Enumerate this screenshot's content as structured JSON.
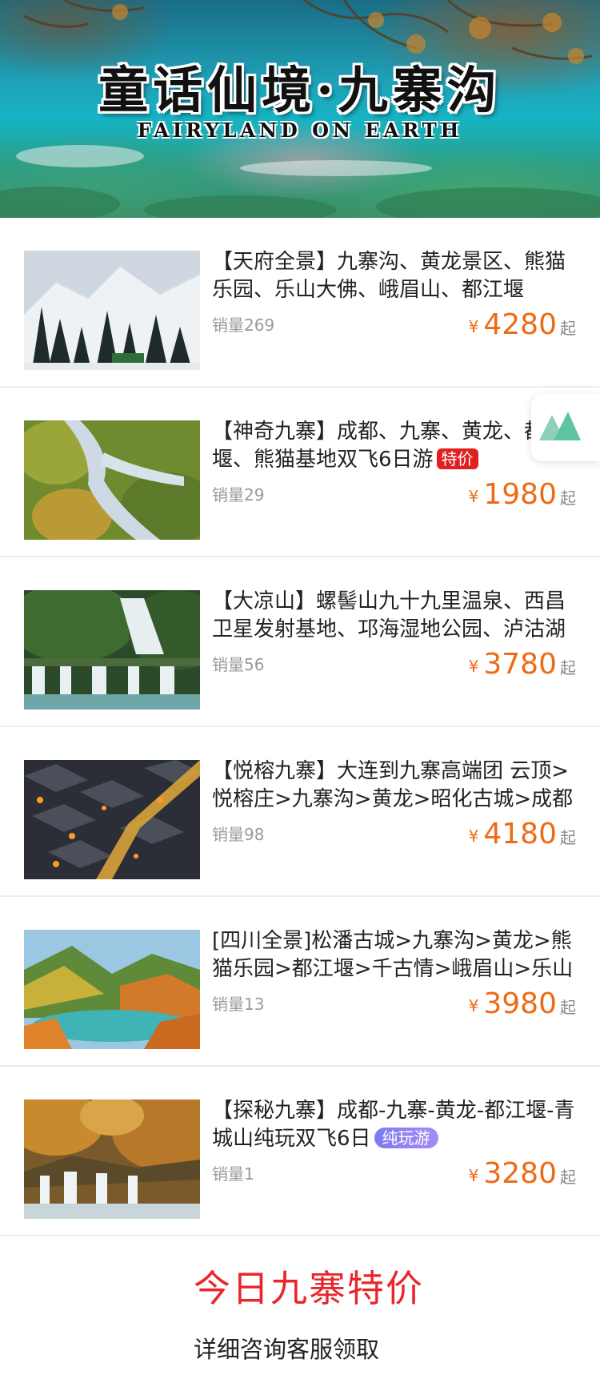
{
  "banner": {
    "title": "童话仙境·九寨沟",
    "subtitle": "FAIRYLAND ON EARTH"
  },
  "currency_symbol": "¥",
  "price_suffix": "起",
  "products": [
    {
      "title": "【天府全景】九寨沟、黄龙景区、熊猫乐园、乐山大佛、峨眉山、都江堰",
      "tag": "",
      "sales": "销量269",
      "price": "4280",
      "image": "snowy-forest-mountain"
    },
    {
      "title": "【神奇九寨】成都、九寨、黄龙、都江堰、熊猫基地双飞6日游",
      "tag": "特价",
      "sales": "销量29",
      "price": "1980",
      "image": "aerial-waterfall-valley"
    },
    {
      "title": "【大凉山】螺髻山九十九里温泉、西昌卫星发射基地、邛海湿地公园、泸沽湖",
      "tag": "",
      "sales": "销量56",
      "price": "3780",
      "image": "cascading-waterfalls"
    },
    {
      "title": "【悦榕九寨】大连到九寨高端团 云顶>悦榕庄>九寨沟>黄龙>昭化古城>成都",
      "tag": "",
      "sales": "销量98",
      "price": "4180",
      "image": "ancient-town-night"
    },
    {
      "title": "[四川全景]松潘古城>九寨沟>黄龙>熊猫乐园>都江堰>千古情>峨眉山>乐山",
      "tag": "",
      "sales": "销量13",
      "price": "3980",
      "image": "autumn-lake-mountains"
    },
    {
      "title": "【探秘九寨】成都-九寨-黄龙-都江堰-青城山纯玩双飞6日",
      "tag": "纯玩游",
      "sales": "销量1",
      "price": "3280",
      "image": "autumn-waterfall"
    }
  ],
  "float_badge": {
    "icon": "mountain-logo-icon"
  },
  "footer": {
    "title": "今日九寨特价",
    "subtitle": "详细咨询客服领取"
  }
}
